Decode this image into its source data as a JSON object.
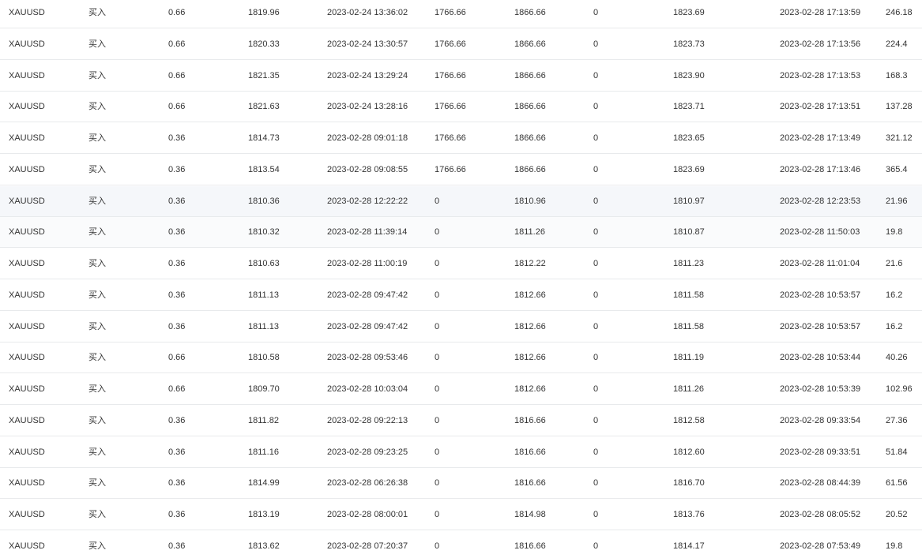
{
  "rows": [
    {
      "symbol": "XAUUSD",
      "side": "买入",
      "lots": "0.66",
      "open_price": "1819.96",
      "open_time": "2023-02-24 13:36:02",
      "sl": "1766.66",
      "tp": "1866.66",
      "swap": "0",
      "close_price": "1823.69",
      "close_time": "2023-02-28 17:13:59",
      "profit": "246.18"
    },
    {
      "symbol": "XAUUSD",
      "side": "买入",
      "lots": "0.66",
      "open_price": "1820.33",
      "open_time": "2023-02-24 13:30:57",
      "sl": "1766.66",
      "tp": "1866.66",
      "swap": "0",
      "close_price": "1823.73",
      "close_time": "2023-02-28 17:13:56",
      "profit": "224.4"
    },
    {
      "symbol": "XAUUSD",
      "side": "买入",
      "lots": "0.66",
      "open_price": "1821.35",
      "open_time": "2023-02-24 13:29:24",
      "sl": "1766.66",
      "tp": "1866.66",
      "swap": "0",
      "close_price": "1823.90",
      "close_time": "2023-02-28 17:13:53",
      "profit": "168.3"
    },
    {
      "symbol": "XAUUSD",
      "side": "买入",
      "lots": "0.66",
      "open_price": "1821.63",
      "open_time": "2023-02-24 13:28:16",
      "sl": "1766.66",
      "tp": "1866.66",
      "swap": "0",
      "close_price": "1823.71",
      "close_time": "2023-02-28 17:13:51",
      "profit": "137.28"
    },
    {
      "symbol": "XAUUSD",
      "side": "买入",
      "lots": "0.36",
      "open_price": "1814.73",
      "open_time": "2023-02-28 09:01:18",
      "sl": "1766.66",
      "tp": "1866.66",
      "swap": "0",
      "close_price": "1823.65",
      "close_time": "2023-02-28 17:13:49",
      "profit": "321.12"
    },
    {
      "symbol": "XAUUSD",
      "side": "买入",
      "lots": "0.36",
      "open_price": "1813.54",
      "open_time": "2023-02-28 09:08:55",
      "sl": "1766.66",
      "tp": "1866.66",
      "swap": "0",
      "close_price": "1823.69",
      "close_time": "2023-02-28 17:13:46",
      "profit": "365.4"
    },
    {
      "symbol": "XAUUSD",
      "side": "买入",
      "lots": "0.36",
      "open_price": "1810.36",
      "open_time": "2023-02-28 12:22:22",
      "sl": "0",
      "tp": "1810.96",
      "swap": "0",
      "close_price": "1810.97",
      "close_time": "2023-02-28 12:23:53",
      "profit": "21.96"
    },
    {
      "symbol": "XAUUSD",
      "side": "买入",
      "lots": "0.36",
      "open_price": "1810.32",
      "open_time": "2023-02-28 11:39:14",
      "sl": "0",
      "tp": "1811.26",
      "swap": "0",
      "close_price": "1810.87",
      "close_time": "2023-02-28 11:50:03",
      "profit": "19.8"
    },
    {
      "symbol": "XAUUSD",
      "side": "买入",
      "lots": "0.36",
      "open_price": "1810.63",
      "open_time": "2023-02-28 11:00:19",
      "sl": "0",
      "tp": "1812.22",
      "swap": "0",
      "close_price": "1811.23",
      "close_time": "2023-02-28 11:01:04",
      "profit": "21.6"
    },
    {
      "symbol": "XAUUSD",
      "side": "买入",
      "lots": "0.36",
      "open_price": "1811.13",
      "open_time": "2023-02-28 09:47:42",
      "sl": "0",
      "tp": "1812.66",
      "swap": "0",
      "close_price": "1811.58",
      "close_time": "2023-02-28 10:53:57",
      "profit": "16.2"
    },
    {
      "symbol": "XAUUSD",
      "side": "买入",
      "lots": "0.36",
      "open_price": "1811.13",
      "open_time": "2023-02-28 09:47:42",
      "sl": "0",
      "tp": "1812.66",
      "swap": "0",
      "close_price": "1811.58",
      "close_time": "2023-02-28 10:53:57",
      "profit": "16.2"
    },
    {
      "symbol": "XAUUSD",
      "side": "买入",
      "lots": "0.66",
      "open_price": "1810.58",
      "open_time": "2023-02-28 09:53:46",
      "sl": "0",
      "tp": "1812.66",
      "swap": "0",
      "close_price": "1811.19",
      "close_time": "2023-02-28 10:53:44",
      "profit": "40.26"
    },
    {
      "symbol": "XAUUSD",
      "side": "买入",
      "lots": "0.66",
      "open_price": "1809.70",
      "open_time": "2023-02-28 10:03:04",
      "sl": "0",
      "tp": "1812.66",
      "swap": "0",
      "close_price": "1811.26",
      "close_time": "2023-02-28 10:53:39",
      "profit": "102.96"
    },
    {
      "symbol": "XAUUSD",
      "side": "买入",
      "lots": "0.36",
      "open_price": "1811.82",
      "open_time": "2023-02-28 09:22:13",
      "sl": "0",
      "tp": "1816.66",
      "swap": "0",
      "close_price": "1812.58",
      "close_time": "2023-02-28 09:33:54",
      "profit": "27.36"
    },
    {
      "symbol": "XAUUSD",
      "side": "买入",
      "lots": "0.36",
      "open_price": "1811.16",
      "open_time": "2023-02-28 09:23:25",
      "sl": "0",
      "tp": "1816.66",
      "swap": "0",
      "close_price": "1812.60",
      "close_time": "2023-02-28 09:33:51",
      "profit": "51.84"
    },
    {
      "symbol": "XAUUSD",
      "side": "买入",
      "lots": "0.36",
      "open_price": "1814.99",
      "open_time": "2023-02-28 06:26:38",
      "sl": "0",
      "tp": "1816.66",
      "swap": "0",
      "close_price": "1816.70",
      "close_time": "2023-02-28 08:44:39",
      "profit": "61.56"
    },
    {
      "symbol": "XAUUSD",
      "side": "买入",
      "lots": "0.36",
      "open_price": "1813.19",
      "open_time": "2023-02-28 08:00:01",
      "sl": "0",
      "tp": "1814.98",
      "swap": "0",
      "close_price": "1813.76",
      "close_time": "2023-02-28 08:05:52",
      "profit": "20.52"
    },
    {
      "symbol": "XAUUSD",
      "side": "买入",
      "lots": "0.36",
      "open_price": "1813.62",
      "open_time": "2023-02-28 07:20:37",
      "sl": "0",
      "tp": "1816.66",
      "swap": "0",
      "close_price": "1814.17",
      "close_time": "2023-02-28 07:53:49",
      "profit": "19.8"
    }
  ],
  "hover_row_index": 6,
  "colors": {
    "text": "#333333",
    "row_border": "#e8eaec",
    "hover_row_bg": "#f5f7fa"
  }
}
